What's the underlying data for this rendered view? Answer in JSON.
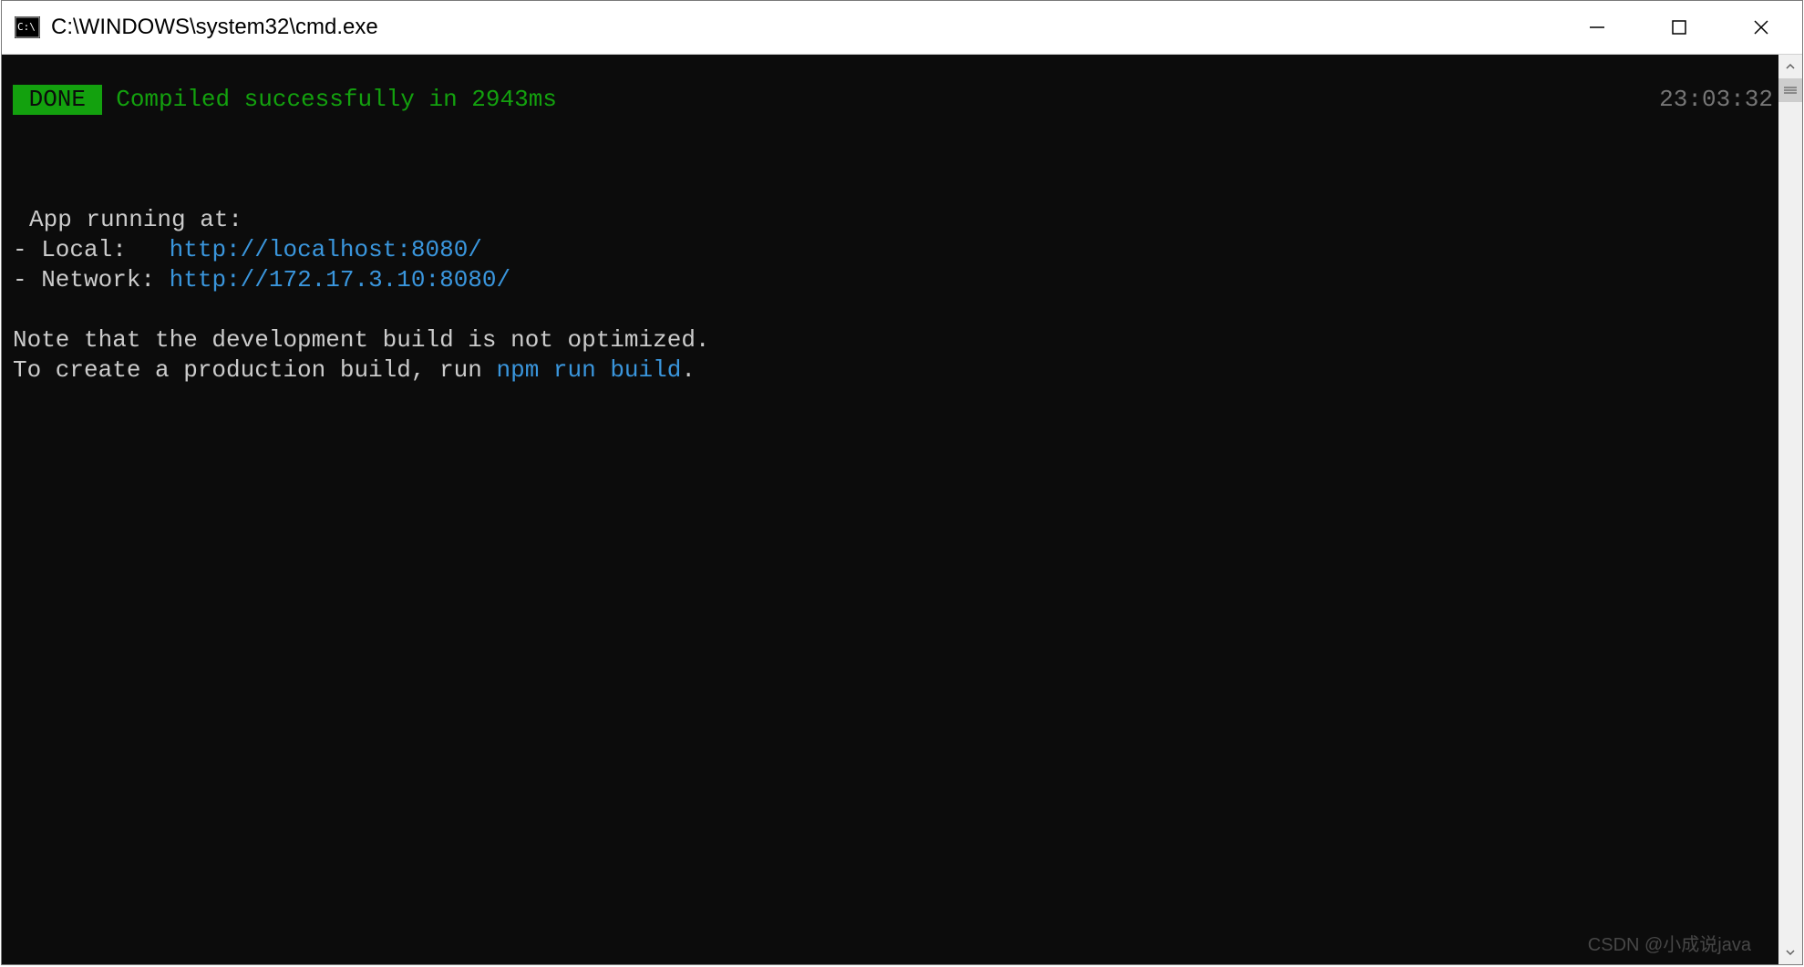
{
  "window": {
    "title": "C:\\WINDOWS\\system32\\cmd.exe"
  },
  "status": {
    "badge": " DONE ",
    "message": " Compiled successfully in 2943ms",
    "timestamp": "23:03:32"
  },
  "output": {
    "running_at": "App running at:",
    "local_prefix": "- Local:   ",
    "local_url": "http://localhost:8080/",
    "network_prefix": "- Network: ",
    "network_url": "http://172.17.3.10:8080/",
    "note_line1": "Note that the development build is not optimized.",
    "note_line2_pre": "To create a production build, run ",
    "note_cmd": "npm run build",
    "note_line2_post": "."
  },
  "watermark": "CSDN @小成说java"
}
